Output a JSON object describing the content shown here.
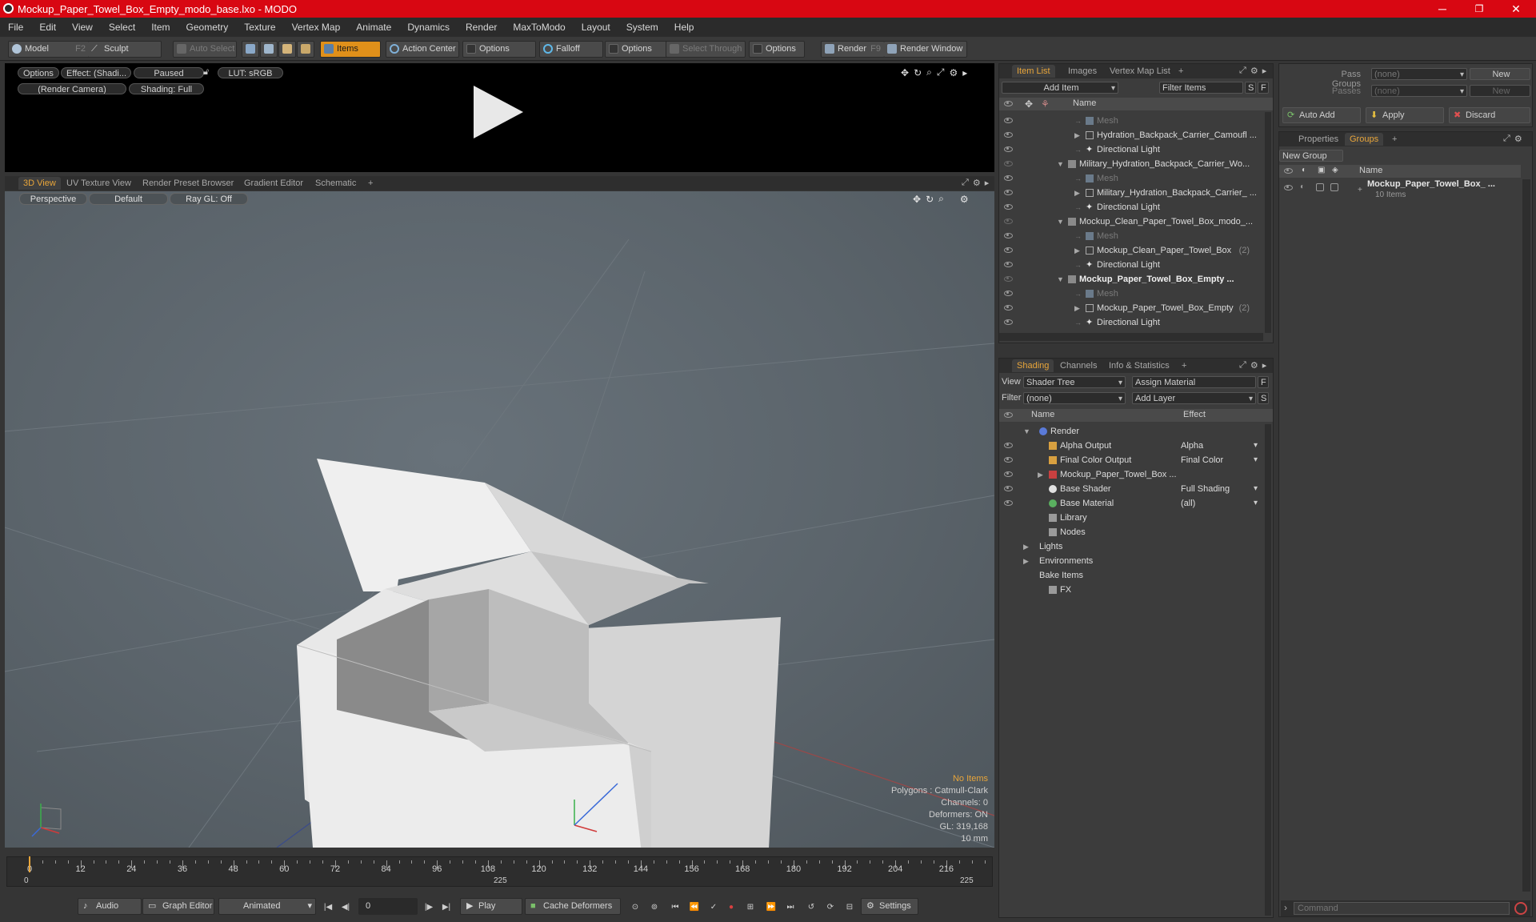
{
  "window": {
    "title": "Mockup_Paper_Towel_Box_Empty_modo_base.lxo - MODO",
    "minimize": "─",
    "maximize": "❐",
    "close": "✕"
  },
  "menu": [
    "File",
    "Edit",
    "View",
    "Select",
    "Item",
    "Geometry",
    "Texture",
    "Vertex Map",
    "Animate",
    "Dynamics",
    "Render",
    "MaxToModo",
    "Layout",
    "System",
    "Help"
  ],
  "toolbar": {
    "model": "Model",
    "model_key": "F2",
    "sculpt": "Sculpt",
    "auto_select": "Auto Select",
    "items": "Items",
    "action_center": "Action Center",
    "options1": "Options",
    "falloff": "Falloff",
    "options2": "Options",
    "select_through": "Select Through",
    "options3": "Options",
    "render": "Render",
    "render_key": "F9",
    "render_window": "Render Window"
  },
  "render_preview": {
    "options": "Options",
    "effect": "Effect: (Shadi...",
    "paused": "Paused",
    "lut": "LUT: sRGB",
    "camera": "(Render Camera)",
    "shading": "Shading: Full"
  },
  "viewport_tabs": [
    "3D View",
    "UV Texture View",
    "Render Preset Browser",
    "Gradient Editor",
    "Schematic",
    "+"
  ],
  "viewport": {
    "perspective": "Perspective",
    "default": "Default",
    "raygl": "Ray GL: Off",
    "info": {
      "no_items": "No Items",
      "polygons": "Polygons : Catmull-Clark",
      "channels": "Channels: 0",
      "deformers": "Deformers: ON",
      "gl": "GL: 319,168",
      "scale": "10 mm"
    }
  },
  "timeline": {
    "ticks": [
      "0",
      "12",
      "24",
      "36",
      "48",
      "60",
      "72",
      "84",
      "96",
      "108",
      "120",
      "132",
      "144",
      "156",
      "168",
      "180",
      "192",
      "204",
      "216"
    ],
    "start": "0",
    "mid": "225",
    "end": "225"
  },
  "bottom": {
    "audio": "Audio",
    "graph_editor": "Graph Editor",
    "animated": "Animated",
    "frame": "0",
    "play": "Play",
    "cache_deformers": "Cache Deformers",
    "settings": "Settings"
  },
  "item_list": {
    "tabs": [
      "Item List",
      "Images",
      "Vertex Map List",
      "+"
    ],
    "add_item": "Add Item",
    "filter_items": "Filter Items",
    "s": "S",
    "f": "F",
    "col_name": "Name",
    "rows": [
      {
        "label": "Mesh",
        "indent": 2,
        "kind": "mesh",
        "tri": ""
      },
      {
        "label": "Hydration_Backpack_Carrier_Camoufl ...",
        "indent": 2,
        "kind": "loc",
        "tri": "▶"
      },
      {
        "label": "Directional Light",
        "indent": 2,
        "kind": "light",
        "tri": ""
      },
      {
        "label": "Military_Hydration_Backpack_Carrier_Wo...",
        "indent": 1,
        "kind": "scene",
        "tri": "▼"
      },
      {
        "label": "Mesh",
        "indent": 2,
        "kind": "mesh",
        "tri": ""
      },
      {
        "label": "Military_Hydration_Backpack_Carrier_ ...",
        "indent": 2,
        "kind": "loc",
        "tri": "▶"
      },
      {
        "label": "Directional Light",
        "indent": 2,
        "kind": "light",
        "tri": ""
      },
      {
        "label": "Mockup_Clean_Paper_Towel_Box_modo_...",
        "indent": 1,
        "kind": "scene",
        "tri": "▼"
      },
      {
        "label": "Mesh",
        "indent": 2,
        "kind": "mesh",
        "tri": ""
      },
      {
        "label": "Mockup_Clean_Paper_Towel_Box",
        "suffix": "(2)",
        "indent": 2,
        "kind": "loc",
        "tri": "▶"
      },
      {
        "label": "Directional Light",
        "indent": 2,
        "kind": "light",
        "tri": ""
      },
      {
        "label": "Mockup_Paper_Towel_Box_Empty ...",
        "indent": 1,
        "kind": "scene",
        "tri": "▼",
        "bold": true
      },
      {
        "label": "Mesh",
        "indent": 2,
        "kind": "mesh",
        "tri": ""
      },
      {
        "label": "Mockup_Paper_Towel_Box_Empty",
        "suffix": "(2)",
        "indent": 2,
        "kind": "loc",
        "tri": "▶"
      },
      {
        "label": "Directional Light",
        "indent": 2,
        "kind": "light",
        "tri": ""
      }
    ]
  },
  "shading": {
    "tabs": [
      "Shading",
      "Channels",
      "Info & Statistics",
      "+"
    ],
    "view_label": "View",
    "view_value": "Shader Tree",
    "assign_material": "Assign Material",
    "f": "F",
    "filter_label": "Filter",
    "filter_value": "(none)",
    "add_layer": "Add Layer",
    "s": "S",
    "col_name": "Name",
    "col_effect": "Effect",
    "rows": [
      {
        "label": "Render",
        "effect": "",
        "indent": 0,
        "tri": "▼",
        "icon": "render",
        "eye": false
      },
      {
        "label": "Alpha Output",
        "effect": "Alpha",
        "indent": 1,
        "tri": "",
        "icon": "output",
        "eye": true
      },
      {
        "label": "Final Color Output",
        "effect": "Final Color",
        "indent": 1,
        "tri": "",
        "icon": "output",
        "eye": true
      },
      {
        "label": "Mockup_Paper_Towel_Box ...",
        "effect": "",
        "indent": 1,
        "tri": "▶",
        "icon": "mask",
        "eye": true
      },
      {
        "label": "Base Shader",
        "effect": "Full Shading",
        "indent": 1,
        "tri": "",
        "icon": "shader",
        "eye": true
      },
      {
        "label": "Base Material",
        "effect": "(all)",
        "indent": 1,
        "tri": "",
        "icon": "material",
        "eye": true
      },
      {
        "label": "Library",
        "effect": "",
        "indent": 1,
        "tri": "",
        "icon": "folder",
        "eye": false
      },
      {
        "label": "Nodes",
        "effect": "",
        "indent": 1,
        "tri": "",
        "icon": "folder",
        "eye": false
      },
      {
        "label": "Lights",
        "effect": "",
        "indent": 0,
        "tri": "▶",
        "icon": "",
        "eye": false
      },
      {
        "label": "Environments",
        "effect": "",
        "indent": 0,
        "tri": "▶",
        "icon": "",
        "eye": false
      },
      {
        "label": "Bake Items",
        "effect": "",
        "indent": 0,
        "tri": "",
        "icon": "",
        "eye": false
      },
      {
        "label": "FX",
        "effect": "",
        "indent": 1,
        "tri": "",
        "icon": "fx",
        "eye": false
      }
    ]
  },
  "pass": {
    "pass_groups": "Pass Groups",
    "pass_groups_value": "(none)",
    "new1": "New",
    "passes": "Passes",
    "passes_value": "(none)",
    "new2": "New",
    "auto_add": "Auto Add",
    "apply": "Apply",
    "discard": "Discard"
  },
  "groups": {
    "tabs": [
      "Properties",
      "Groups",
      "+"
    ],
    "new_group": "New Group",
    "col_name": "Name",
    "item": "Mockup_Paper_Towel_Box_ ...",
    "count": "10 Items"
  },
  "command": {
    "placeholder": "Command"
  },
  "colors": {
    "accent": "#e8a53a",
    "titlebar": "#d80712"
  }
}
